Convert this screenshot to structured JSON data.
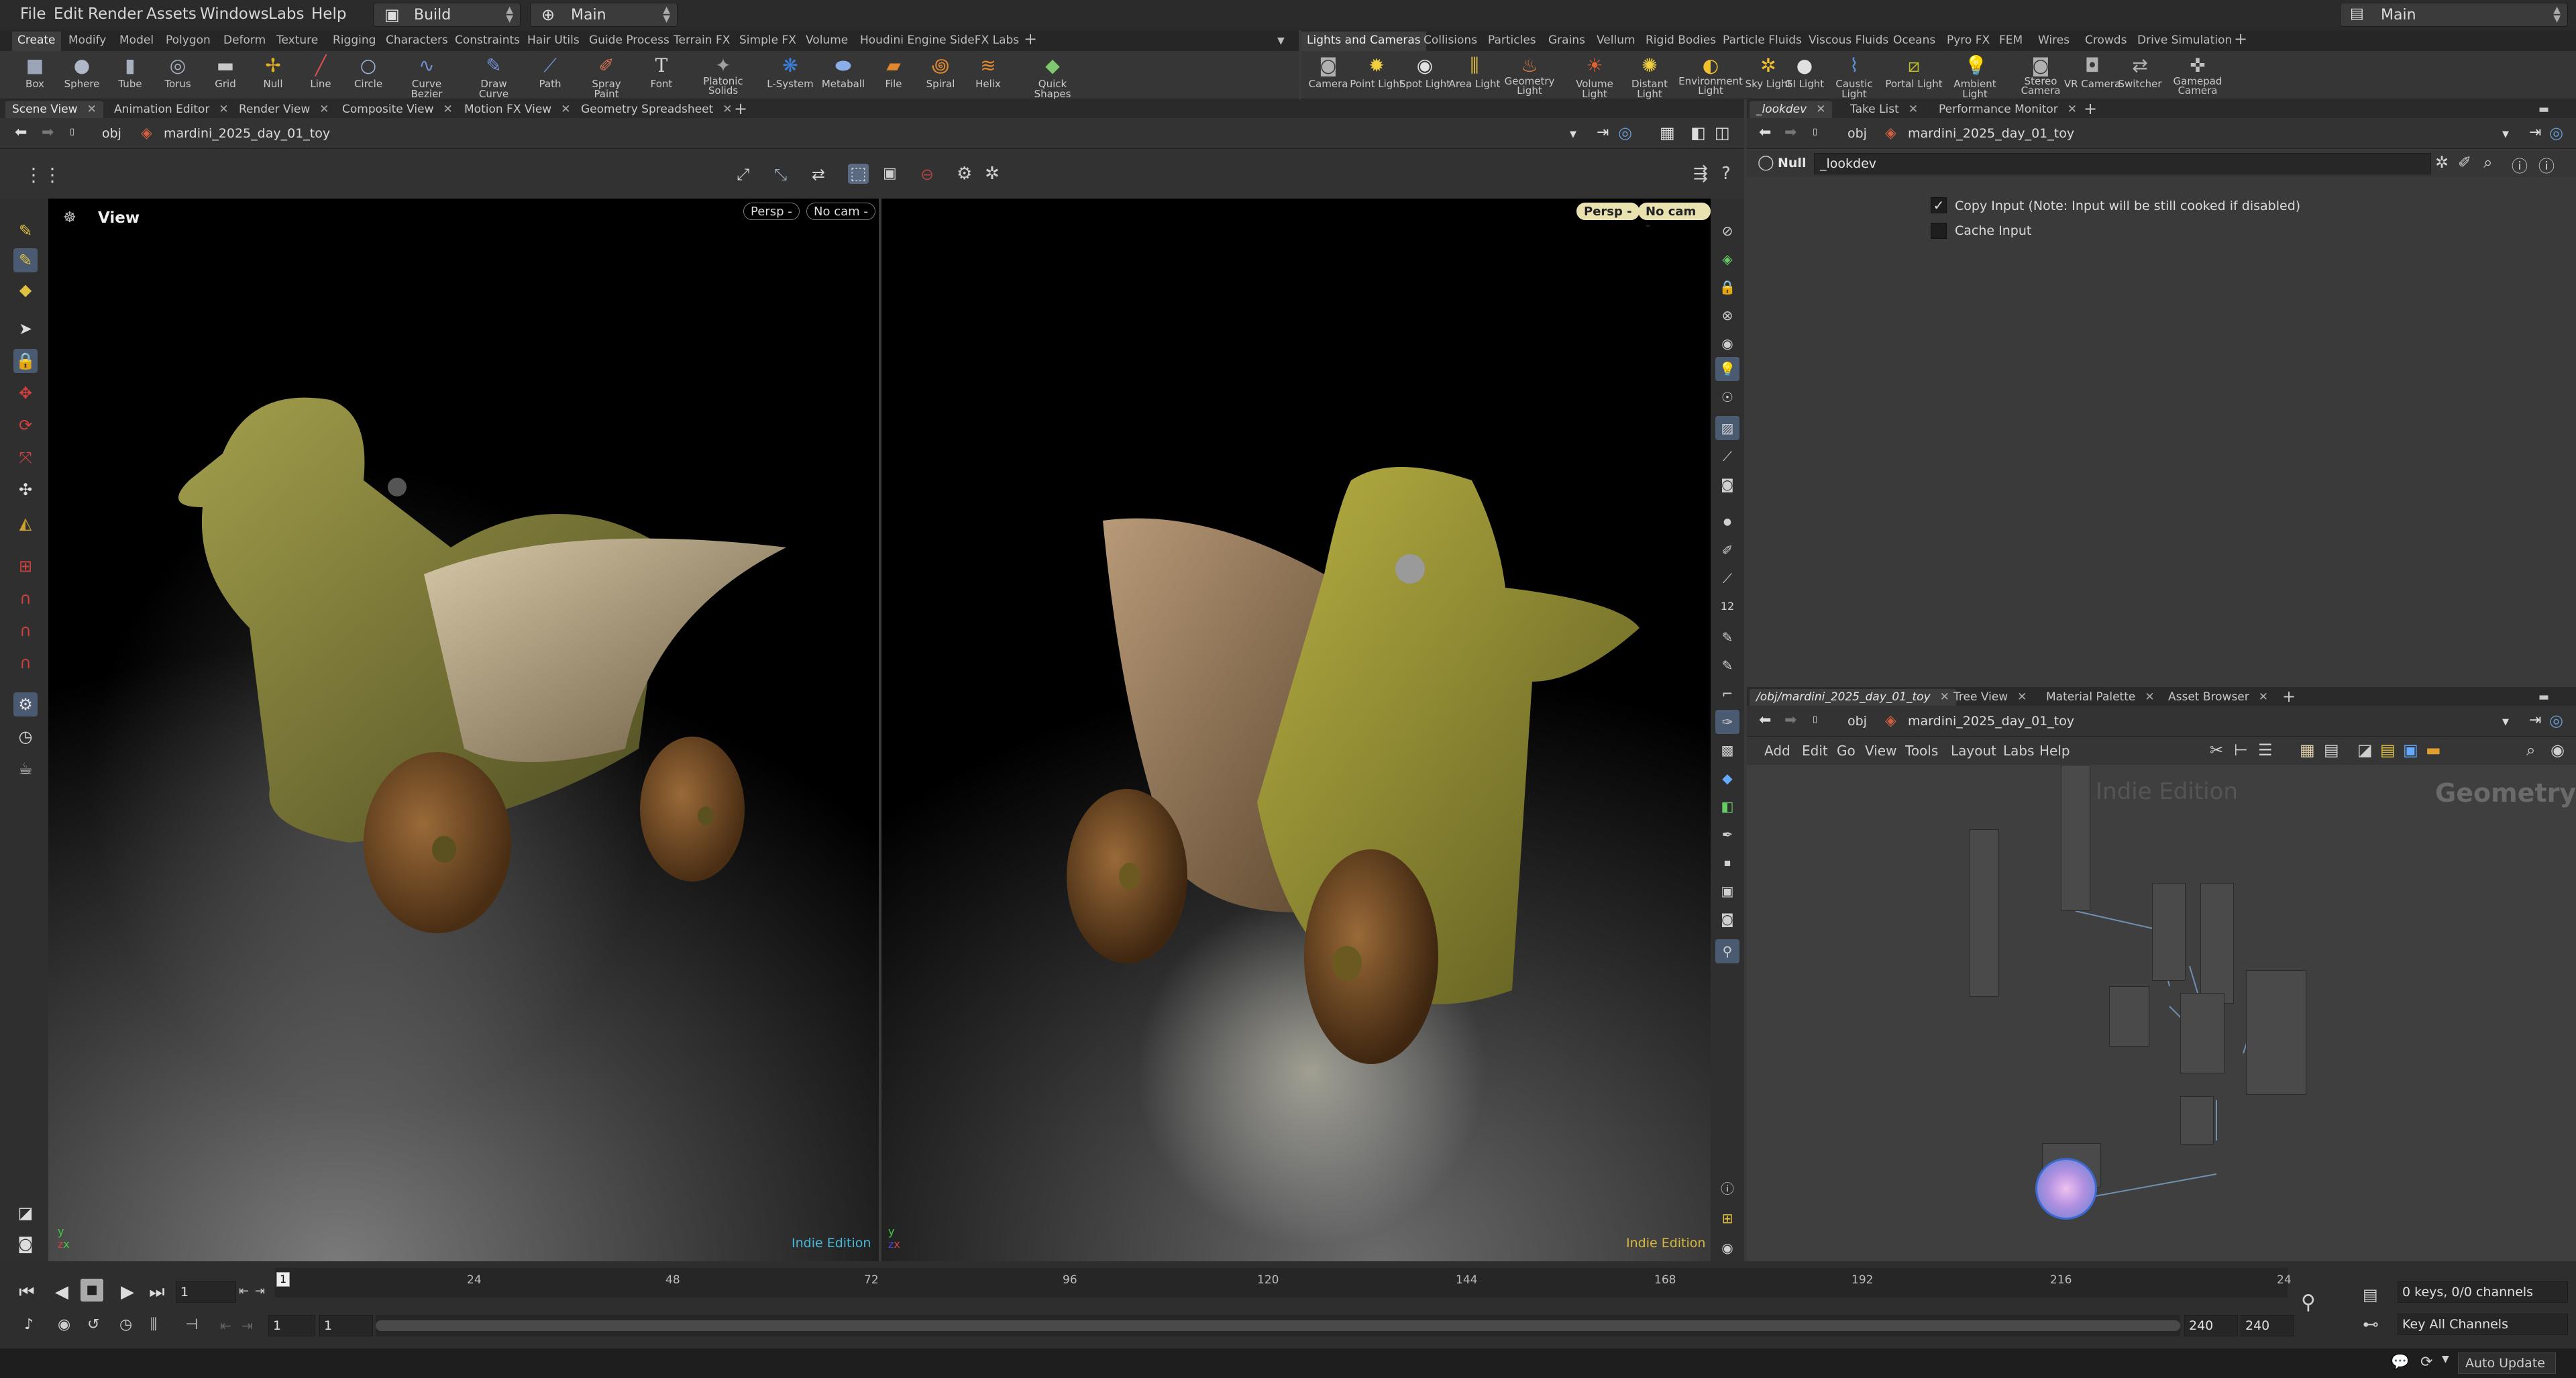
{
  "menubar": {
    "items": [
      "File",
      "Edit",
      "Render",
      "Assets",
      "Windows",
      "Labs",
      "Help"
    ],
    "desktop": "Build",
    "context": "Main",
    "right_desktop": "Main"
  },
  "shelf_left": {
    "tabs": [
      "Create",
      "Modify",
      "Model",
      "Polygon",
      "Deform",
      "Texture",
      "Rigging",
      "Characters",
      "Constraints",
      "Hair Utils",
      "Guide Process",
      "Terrain FX",
      "Simple FX",
      "Volume",
      "Houdini Engine",
      "SideFX Labs"
    ],
    "tools": [
      "Box",
      "Sphere",
      "Tube",
      "Torus",
      "Grid",
      "Null",
      "Line",
      "Circle",
      "Curve Bezier",
      "Draw Curve",
      "Path",
      "Spray Paint",
      "Font",
      "Platonic Solids",
      "L-System",
      "Metaball",
      "File",
      "Spiral",
      "Helix",
      "Quick Shapes"
    ]
  },
  "shelf_right": {
    "tabs": [
      "Lights and Cameras",
      "Collisions",
      "Particles",
      "Grains",
      "Vellum",
      "Rigid Bodies",
      "Particle Fluids",
      "Viscous Fluids",
      "Oceans",
      "Pyro FX",
      "FEM",
      "Wires",
      "Crowds",
      "Drive Simulation"
    ],
    "tools": [
      "Camera",
      "Point Light",
      "Spot Light",
      "Area Light",
      "Geometry Light",
      "Volume Light",
      "Distant Light",
      "Environment Light",
      "Sky Light",
      "GI Light",
      "Caustic Light",
      "Portal Light",
      "Ambient Light",
      "Stereo Camera",
      "VR Camera",
      "Switcher",
      "Gamepad Camera"
    ]
  },
  "left_pane": {
    "tabs": [
      "Scene View",
      "Animation Editor",
      "Render View",
      "Composite View",
      "Motion FX View",
      "Geometry Spreadsheet"
    ],
    "path_root": "obj",
    "path_node": "mardini_2025_day_01_toy",
    "view_label": "View",
    "vp1": {
      "persp": "Persp -",
      "cam": "No cam -",
      "edition": "Indie Edition"
    },
    "vp2": {
      "persp": "Persp -",
      "cam": "No cam -",
      "edition": "Indie Edition"
    }
  },
  "param_pane": {
    "tabs": [
      "_lookdev",
      "Take List",
      "Performance Monitor"
    ],
    "path_root": "obj",
    "path_node": "mardini_2025_day_01_toy",
    "node_type": "Null",
    "node_name": "_lookdev",
    "copy_input_label": "Copy Input (Note: Input will be still cooked if disabled)",
    "copy_input_checked": true,
    "cache_input_label": "Cache Input",
    "cache_input_checked": false
  },
  "network_pane": {
    "tabs": [
      "/obj/mardini_2025_day_01_toy",
      "Tree View",
      "Material Palette",
      "Asset Browser"
    ],
    "path_root": "obj",
    "path_node": "mardini_2025_day_01_toy",
    "menu": [
      "Add",
      "Edit",
      "Go",
      "View",
      "Tools",
      "Layout",
      "Labs",
      "Help"
    ],
    "watermark": "Indie Edition",
    "context_label": "Geometry"
  },
  "timeline": {
    "ticks": [
      "24",
      "48",
      "72",
      "96",
      "120",
      "144",
      "168",
      "192",
      "216",
      "24"
    ],
    "current_frame": "1",
    "current_frame_marker": "1",
    "start": "1",
    "start2": "1",
    "end": "240",
    "end2": "240",
    "keys_label": "0 keys, 0/0 channels",
    "key_all": "Key All Channels",
    "auto_update": "Auto Update"
  },
  "colors": {
    "accent": "#e9e1b0",
    "indie_cyan": "#4ab8d8",
    "indie_yellow": "#d8b840"
  }
}
